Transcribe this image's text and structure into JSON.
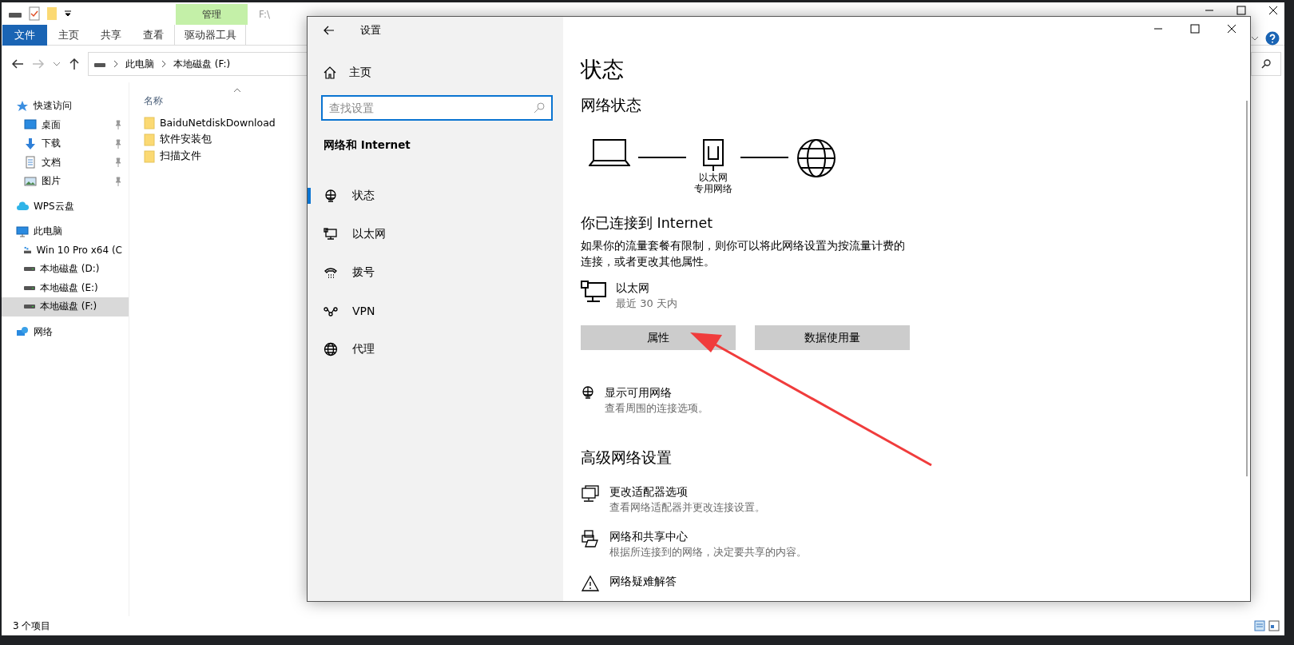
{
  "explorer": {
    "title": "F:\\",
    "contextual_group": "管理",
    "ribbon_tabs": [
      {
        "label": "文件",
        "kind": "file"
      },
      {
        "label": "主页",
        "kind": "tab"
      },
      {
        "label": "共享",
        "kind": "tab"
      },
      {
        "label": "查看",
        "kind": "tab"
      },
      {
        "label": "驱动器工具",
        "kind": "contextual"
      }
    ],
    "breadcrumb": [
      "此电脑",
      "本地磁盘 (F:)"
    ],
    "nav": [
      {
        "label": "快速访问",
        "kind": "star",
        "selected": false,
        "children": [
          {
            "label": "桌面",
            "kind": "desktop",
            "pinned": true,
            "selected": false
          },
          {
            "label": "下载",
            "kind": "download",
            "pinned": true,
            "selected": false
          },
          {
            "label": "文档",
            "kind": "document",
            "pinned": true,
            "selected": false
          },
          {
            "label": "图片",
            "kind": "picture",
            "pinned": true,
            "selected": false
          }
        ]
      },
      {
        "label": "WPS云盘",
        "kind": "cloud",
        "selected": false
      },
      {
        "label": "此电脑",
        "kind": "pc",
        "selected": false,
        "children": [
          {
            "label": "Win 10 Pro x64 (C",
            "kind": "system-drive",
            "pinned": false,
            "selected": false
          },
          {
            "label": "本地磁盘 (D:)",
            "kind": "drive",
            "pinned": false,
            "selected": false
          },
          {
            "label": "本地磁盘 (E:)",
            "kind": "drive",
            "pinned": false,
            "selected": false
          },
          {
            "label": "本地磁盘 (F:)",
            "kind": "drive",
            "pinned": false,
            "selected": true
          }
        ]
      },
      {
        "label": "网络",
        "kind": "network",
        "selected": false
      }
    ],
    "column_header": "名称",
    "files": [
      "BaiduNetdiskDownload",
      "软件安装包",
      "扫描文件"
    ],
    "status": "3 个项目"
  },
  "settings": {
    "title": "设置",
    "home": "主页",
    "search": {
      "placeholder": "查找设置"
    },
    "section": "网络和 Internet",
    "nav": [
      {
        "label": "状态",
        "kind": "status",
        "selected": true
      },
      {
        "label": "以太网",
        "kind": "ethernet",
        "selected": false
      },
      {
        "label": "拨号",
        "kind": "dialup",
        "selected": false
      },
      {
        "label": "VPN",
        "kind": "vpn",
        "selected": false
      },
      {
        "label": "代理",
        "kind": "proxy",
        "selected": false
      }
    ],
    "page_title": "状态",
    "network_status": "网络状态",
    "diagram": {
      "adapter": "以太网",
      "profile": "专用网络"
    },
    "connected": "你已连接到 Internet",
    "description": "如果你的流量套餐有限制，则你可以将此网络设置为按流量计费的连接，或者更改其他属性。",
    "connection": {
      "name": "以太网",
      "usage": "最近 30 天内"
    },
    "buttons": [
      "属性",
      "数据使用量"
    ],
    "show_networks": {
      "title": "显示可用网络",
      "subtitle": "查看周围的连接选项。"
    },
    "advanced_heading": "高级网络设置",
    "advanced": [
      {
        "kind": "adapter",
        "title": "更改适配器选项",
        "subtitle": "查看网络适配器并更改连接设置。"
      },
      {
        "kind": "sharing",
        "title": "网络和共享中心",
        "subtitle": "根据所连接到的网络，决定要共享的内容。"
      },
      {
        "kind": "troubleshoot",
        "title": "网络疑难解答"
      }
    ]
  }
}
